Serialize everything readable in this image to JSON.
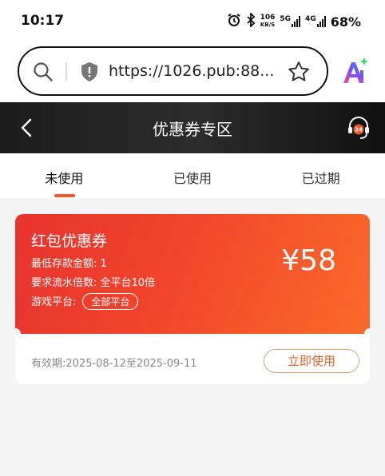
{
  "status_bar": {
    "time": "10:17",
    "net_speed_value": "106",
    "net_speed_unit": "KB/S",
    "signal1_label": "5G",
    "signal2_label": "4G",
    "battery": "68%"
  },
  "browser": {
    "url": "https://1026.pub:88...",
    "icons": [
      "search-icon",
      "shield-icon",
      "star-icon",
      "ai-icon"
    ]
  },
  "header": {
    "title": "优惠券专区",
    "icons": [
      "back-arrow-icon",
      "customer-service-icon"
    ]
  },
  "tabs": [
    {
      "label": "未使用",
      "active": true
    },
    {
      "label": "已使用",
      "active": false
    },
    {
      "label": "已过期",
      "active": false
    }
  ],
  "coupon": {
    "name": "红包优惠券",
    "min_deposit": "最低存款金额: 1",
    "turnover": "要求流水倍数: 全平台10倍",
    "platform_label": "游戏平台:",
    "platform_value": "全部平台",
    "amount": "¥58",
    "validity": "有效期:2025-08-12至2025-09-11",
    "use_button": "立即使用"
  },
  "colors": {
    "accent": "#ef5a2a",
    "coupon_gradient_start": "#e8332f",
    "coupon_gradient_end": "#fa6a2a",
    "header_bg": "#1c1c1c"
  }
}
